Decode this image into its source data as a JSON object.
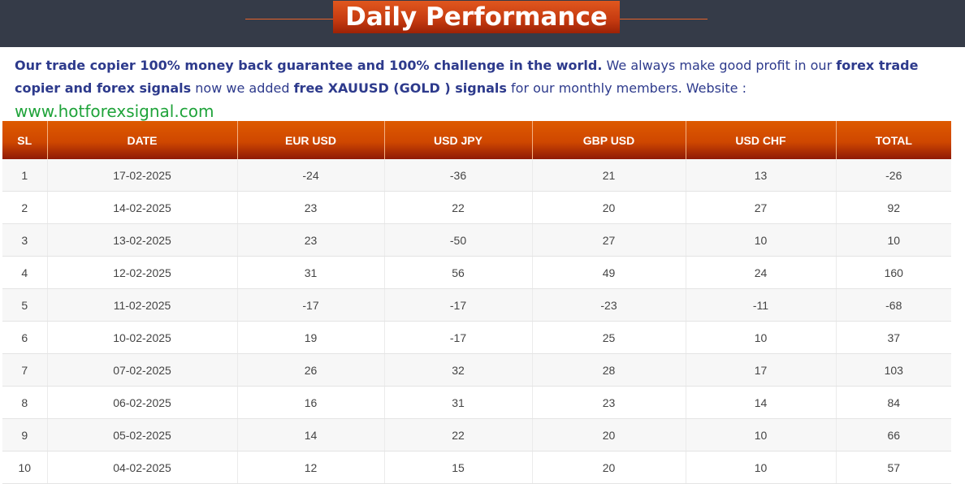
{
  "header": {
    "title": "Daily Performance"
  },
  "intro": {
    "part1": "Our trade copier 100% money back guarantee and 100% challenge in the world.",
    "part2": " We always make good profit in our ",
    "part3": "forex trade copier and forex signals",
    "part4": " now we added ",
    "part5": "free XAUUSD  (GOLD ) signals",
    "part6": " for our monthly members.  Website : ",
    "website": "www.hotforexsignal.com"
  },
  "table": {
    "columns": [
      "SL",
      "DATE",
      "EUR USD",
      "USD JPY",
      "GBP USD",
      "USD CHF",
      "TOTAL"
    ],
    "rows": [
      [
        "1",
        "17-02-2025",
        "-24",
        "-36",
        "21",
        "13",
        "-26"
      ],
      [
        "2",
        "14-02-2025",
        "23",
        "22",
        "20",
        "27",
        "92"
      ],
      [
        "3",
        "13-02-2025",
        "23",
        "-50",
        "27",
        "10",
        "10"
      ],
      [
        "4",
        "12-02-2025",
        "31",
        "56",
        "49",
        "24",
        "160"
      ],
      [
        "5",
        "11-02-2025",
        "-17",
        "-17",
        "-23",
        "-11",
        "-68"
      ],
      [
        "6",
        "10-02-2025",
        "19",
        "-17",
        "25",
        "10",
        "37"
      ],
      [
        "7",
        "07-02-2025",
        "26",
        "32",
        "28",
        "17",
        "103"
      ],
      [
        "8",
        "06-02-2025",
        "16",
        "31",
        "23",
        "14",
        "84"
      ],
      [
        "9",
        "05-02-2025",
        "14",
        "22",
        "20",
        "10",
        "66"
      ],
      [
        "10",
        "04-02-2025",
        "12",
        "15",
        "20",
        "10",
        "57"
      ]
    ]
  },
  "colors": {
    "header_bar": "#353b48",
    "accent_orange": "#d65000",
    "text_blue": "#2d3a8c",
    "link_green": "#1fa33a"
  }
}
